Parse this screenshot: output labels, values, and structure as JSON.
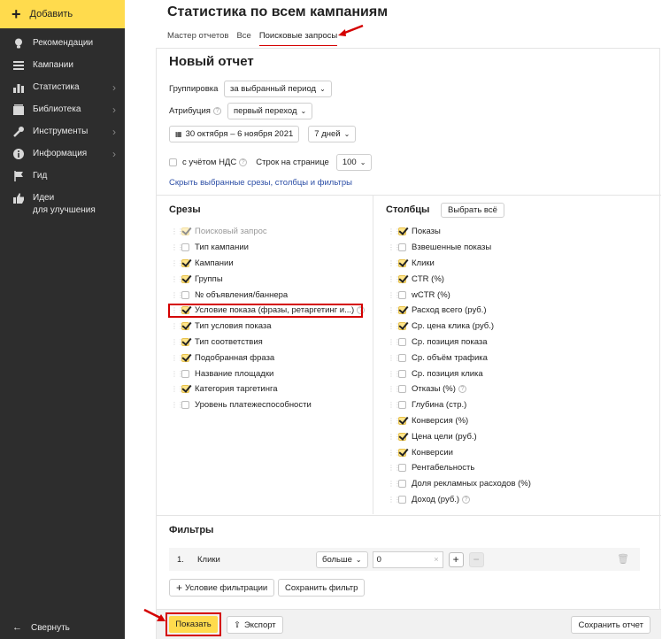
{
  "sidebar": {
    "add_label": "Добавить",
    "items": [
      {
        "label": "Рекомендации",
        "icon": "bulb-icon",
        "chevron": false
      },
      {
        "label": "Кампании",
        "icon": "list-icon",
        "chevron": false
      },
      {
        "label": "Статистика",
        "icon": "chart-icon",
        "chevron": true
      },
      {
        "label": "Библиотека",
        "icon": "library-icon",
        "chevron": true
      },
      {
        "label": "Инструменты",
        "icon": "wrench-icon",
        "chevron": true
      },
      {
        "label": "Информация",
        "icon": "info-icon",
        "chevron": true
      },
      {
        "label": "Гид",
        "icon": "flag-icon",
        "chevron": false
      },
      {
        "label": "Идеи\nдля улучшения",
        "icon": "thumb-icon",
        "chevron": false
      }
    ],
    "collapse_label": "Свернуть"
  },
  "page": {
    "title": "Статистика по всем кампаниям",
    "tabs": [
      "Мастер отчетов",
      "Все",
      "Поисковые запросы"
    ],
    "active_tab": "Поисковые запросы"
  },
  "report": {
    "title": "Новый отчет",
    "grouping_label": "Группировка",
    "grouping_value": "за выбранный период",
    "attribution_label": "Атрибуция",
    "attribution_value": "первый переход",
    "date_range": "30 октября – 6 ноября 2021",
    "period": "7 дней",
    "vat_label": "с учётом НДС",
    "rows_label": "Строк на странице",
    "rows_value": "100",
    "hide_link": "Скрыть выбранные срезы, столбцы и фильтры"
  },
  "slices": {
    "title": "Срезы",
    "items": [
      {
        "label": "Поисковый запрос",
        "checked": true,
        "disabled": true
      },
      {
        "label": "Тип кампании",
        "checked": false
      },
      {
        "label": "Кампании",
        "checked": true
      },
      {
        "label": "Группы",
        "checked": true
      },
      {
        "label": "№ объявления/баннера",
        "checked": false
      },
      {
        "label": "Условие показа (фразы, ретаргетинг и...)",
        "checked": true,
        "help": true
      },
      {
        "label": "Тип условия показа",
        "checked": true
      },
      {
        "label": "Тип соответствия",
        "checked": true
      },
      {
        "label": "Подобранная фраза",
        "checked": true
      },
      {
        "label": "Название площадки",
        "checked": false
      },
      {
        "label": "Категория таргетинга",
        "checked": true
      },
      {
        "label": "Уровень платежеспособности",
        "checked": false
      }
    ]
  },
  "columns": {
    "title": "Столбцы",
    "select_all": "Выбрать всё",
    "items": [
      {
        "label": "Показы",
        "checked": true
      },
      {
        "label": "Взвешенные показы",
        "checked": false
      },
      {
        "label": "Клики",
        "checked": true
      },
      {
        "label": "CTR (%)",
        "checked": true
      },
      {
        "label": "wCTR (%)",
        "checked": false
      },
      {
        "label": "Расход всего (руб.)",
        "checked": true
      },
      {
        "label": "Ср. цена клика (руб.)",
        "checked": true
      },
      {
        "label": "Ср. позиция показа",
        "checked": false
      },
      {
        "label": "Ср. объём трафика",
        "checked": false
      },
      {
        "label": "Ср. позиция клика",
        "checked": false
      },
      {
        "label": "Отказы (%)",
        "checked": false,
        "help": true
      },
      {
        "label": "Глубина (стр.)",
        "checked": false
      },
      {
        "label": "Конверсия (%)",
        "checked": true
      },
      {
        "label": "Цена цели (руб.)",
        "checked": true
      },
      {
        "label": "Конверсии",
        "checked": true
      },
      {
        "label": "Рентабельность",
        "checked": false
      },
      {
        "label": "Доля рекламных расходов (%)",
        "checked": false
      },
      {
        "label": "Доход (руб.)",
        "checked": false,
        "help": true
      }
    ]
  },
  "filters": {
    "title": "Фильтры",
    "row_num": "1.",
    "field": "Клики",
    "operator": "больше",
    "value": "0",
    "add_condition": "Условие фильтрации",
    "save_filter": "Сохранить фильтр"
  },
  "footer": {
    "show": "Показать",
    "export": "Экспорт",
    "save_report": "Сохранить отчет"
  },
  "colors": {
    "accent": "#ffdb4d",
    "highlight": "#d40000",
    "sidebar": "#2d2d2d",
    "link": "#2c4ea6"
  }
}
